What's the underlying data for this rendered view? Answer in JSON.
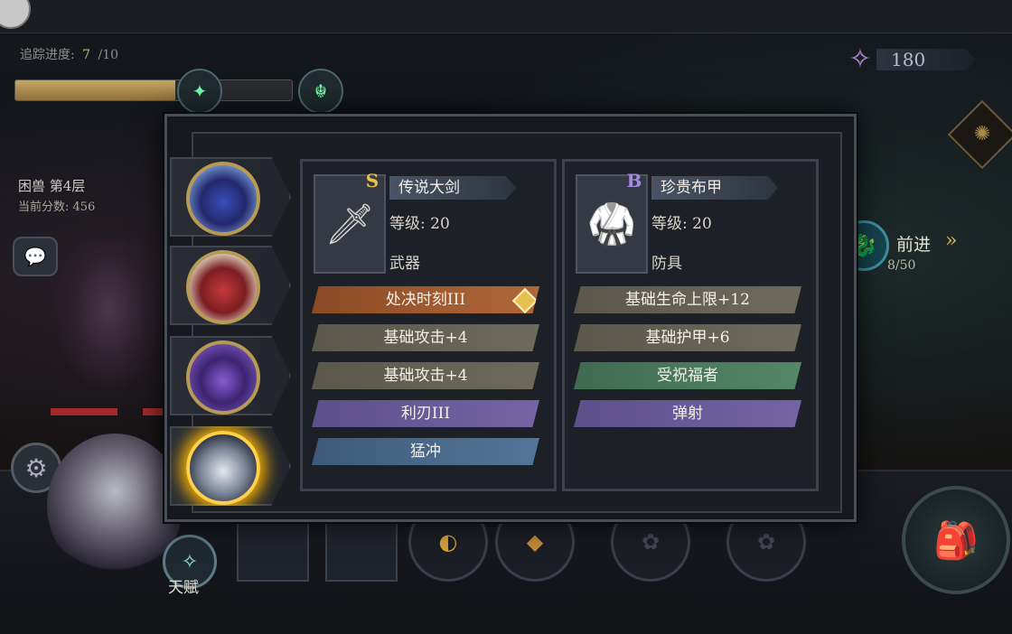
{
  "hud": {
    "track_label": "追踪进度:",
    "track_current": "7",
    "track_total": "/10",
    "track_progress": 0.58,
    "currency_value": "180",
    "floor": "困兽 第4层",
    "score": "当前分数: 456",
    "forward_label": "前进",
    "forward_arrow": "»",
    "forward_count": "8/50",
    "talent_label": "天赋"
  },
  "icons": {
    "currency": "crystal-icon",
    "chat": "chat-icon",
    "settings": "gear-icon",
    "forward": "dragon-icon",
    "map": "map-icon",
    "bag": "bag-icon",
    "talent": "star-icon"
  },
  "party": [
    {
      "name": "witch-hero",
      "active": false
    },
    {
      "name": "red-hood-hero",
      "active": false
    },
    {
      "name": "sorceress-hero",
      "active": false
    },
    {
      "name": "white-hair-hero",
      "active": true
    }
  ],
  "weapon": {
    "rank": "S",
    "rank_color": "#e8c24a",
    "name": "传说大剑",
    "level": "等级: 20",
    "type": "武器",
    "affixes": [
      {
        "text": "处决时刻III",
        "style": "orange",
        "gem": true
      },
      {
        "text": "基础攻击+4",
        "style": "tan"
      },
      {
        "text": "基础攻击+4",
        "style": "tan"
      },
      {
        "text": "利刃III",
        "style": "purple"
      },
      {
        "text": "猛冲",
        "style": "blue"
      }
    ]
  },
  "armor": {
    "rank": "B",
    "rank_color": "#a68ae0",
    "name": "珍贵布甲",
    "level": "等级: 20",
    "type": "防具",
    "affixes": [
      {
        "text": "基础生命上限+12",
        "style": "tan"
      },
      {
        "text": "基础护甲+6",
        "style": "tan"
      },
      {
        "text": "受祝福者",
        "style": "green"
      },
      {
        "text": "弹射",
        "style": "purple"
      }
    ]
  }
}
